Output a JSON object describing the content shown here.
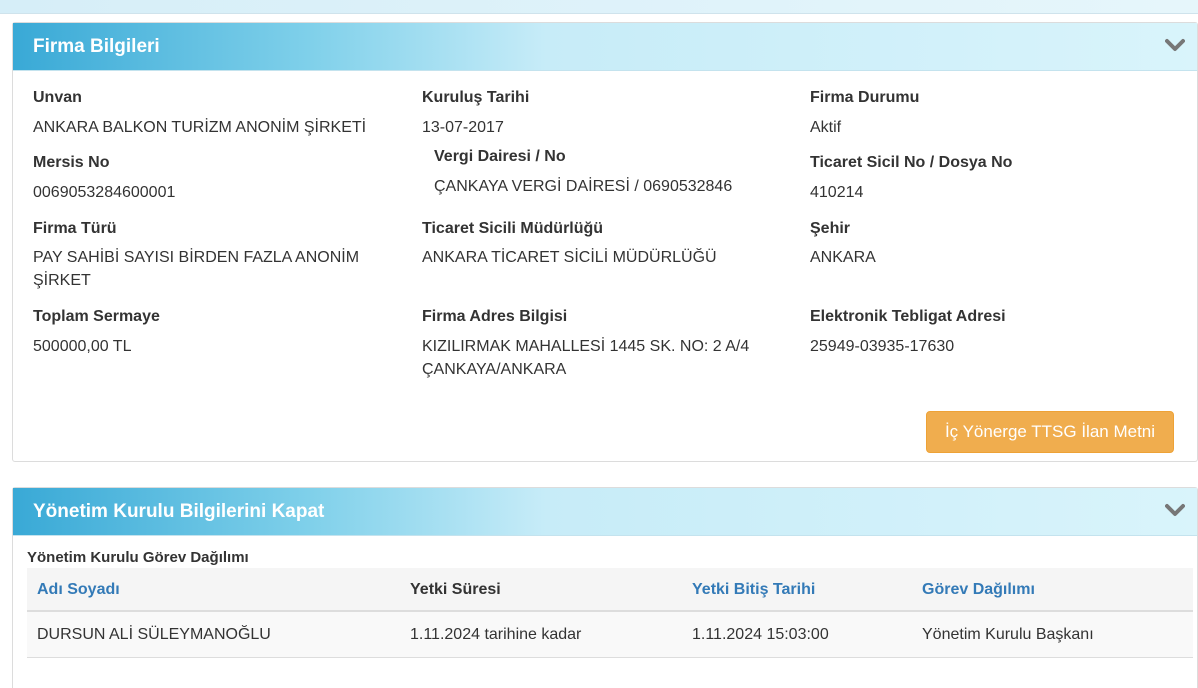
{
  "firma": {
    "title": "Firma Bilgileri",
    "fields": {
      "unvan_label": "Unvan",
      "unvan_value": "ANKARA BALKON TURİZM ANONİM ŞİRKETİ",
      "kurulus_label": "Kuruluş Tarihi",
      "kurulus_value": "13-07-2017",
      "durum_label": "Firma Durumu",
      "durum_value": "Aktif",
      "mersis_label": "Mersis No",
      "mersis_value": "0069053284600001",
      "vergi_label": "Vergi Dairesi / No",
      "vergi_value": "ÇANKAYA VERGİ DAİRESİ / 0690532846",
      "sicil_label": "Ticaret Sicil No / Dosya No",
      "sicil_value": "410214",
      "tur_label": "Firma Türü",
      "tur_value_line1": "PAY SAHİBİ SAYISI BİRDEN FAZLA ANONİM",
      "tur_value_line2": "ŞİRKET",
      "mudurluk_label": "Ticaret Sicili Müdürlüğü",
      "mudurluk_value": "ANKARA TİCARET SİCİLİ MÜDÜRLÜĞÜ",
      "sehir_label": "Şehir",
      "sehir_value": "ANKARA",
      "sermaye_label": "Toplam Sermaye",
      "sermaye_value": "500000,00 TL",
      "adres_label": "Firma Adres Bilgisi",
      "adres_value_line1": "KIZILIRMAK MAHALLESİ 1445 SK. NO: 2 A/4",
      "adres_value_line2": "ÇANKAYA/ANKARA",
      "teblig_label": "Elektronik Tebligat Adresi",
      "teblig_value": "25949-03935-17630"
    },
    "button_label": "İç Yönerge TTSG İlan Metni"
  },
  "yonetim": {
    "title": "Yönetim Kurulu Bilgilerini Kapat",
    "subheading": "Yönetim Kurulu Görev Dağılımı",
    "columns": [
      "Adı Soyadı",
      "Yetki Süresi",
      "Yetki Bitiş Tarihi",
      "Görev Dağılımı"
    ],
    "rows": [
      [
        "DURSUN ALİ SÜLEYMANOĞLU",
        "1.11.2024 tarihine kadar",
        "1.11.2024 15:03:00",
        "Yönetim Kurulu Başkanı"
      ]
    ]
  },
  "colors": {
    "header_gradient_start": "#39a9d6",
    "header_gradient_end": "#d9f4fb",
    "button_orange": "#f0ad4e",
    "link_blue": "#337ab7"
  },
  "icons": {
    "collapse": "chevron-down-icon"
  }
}
